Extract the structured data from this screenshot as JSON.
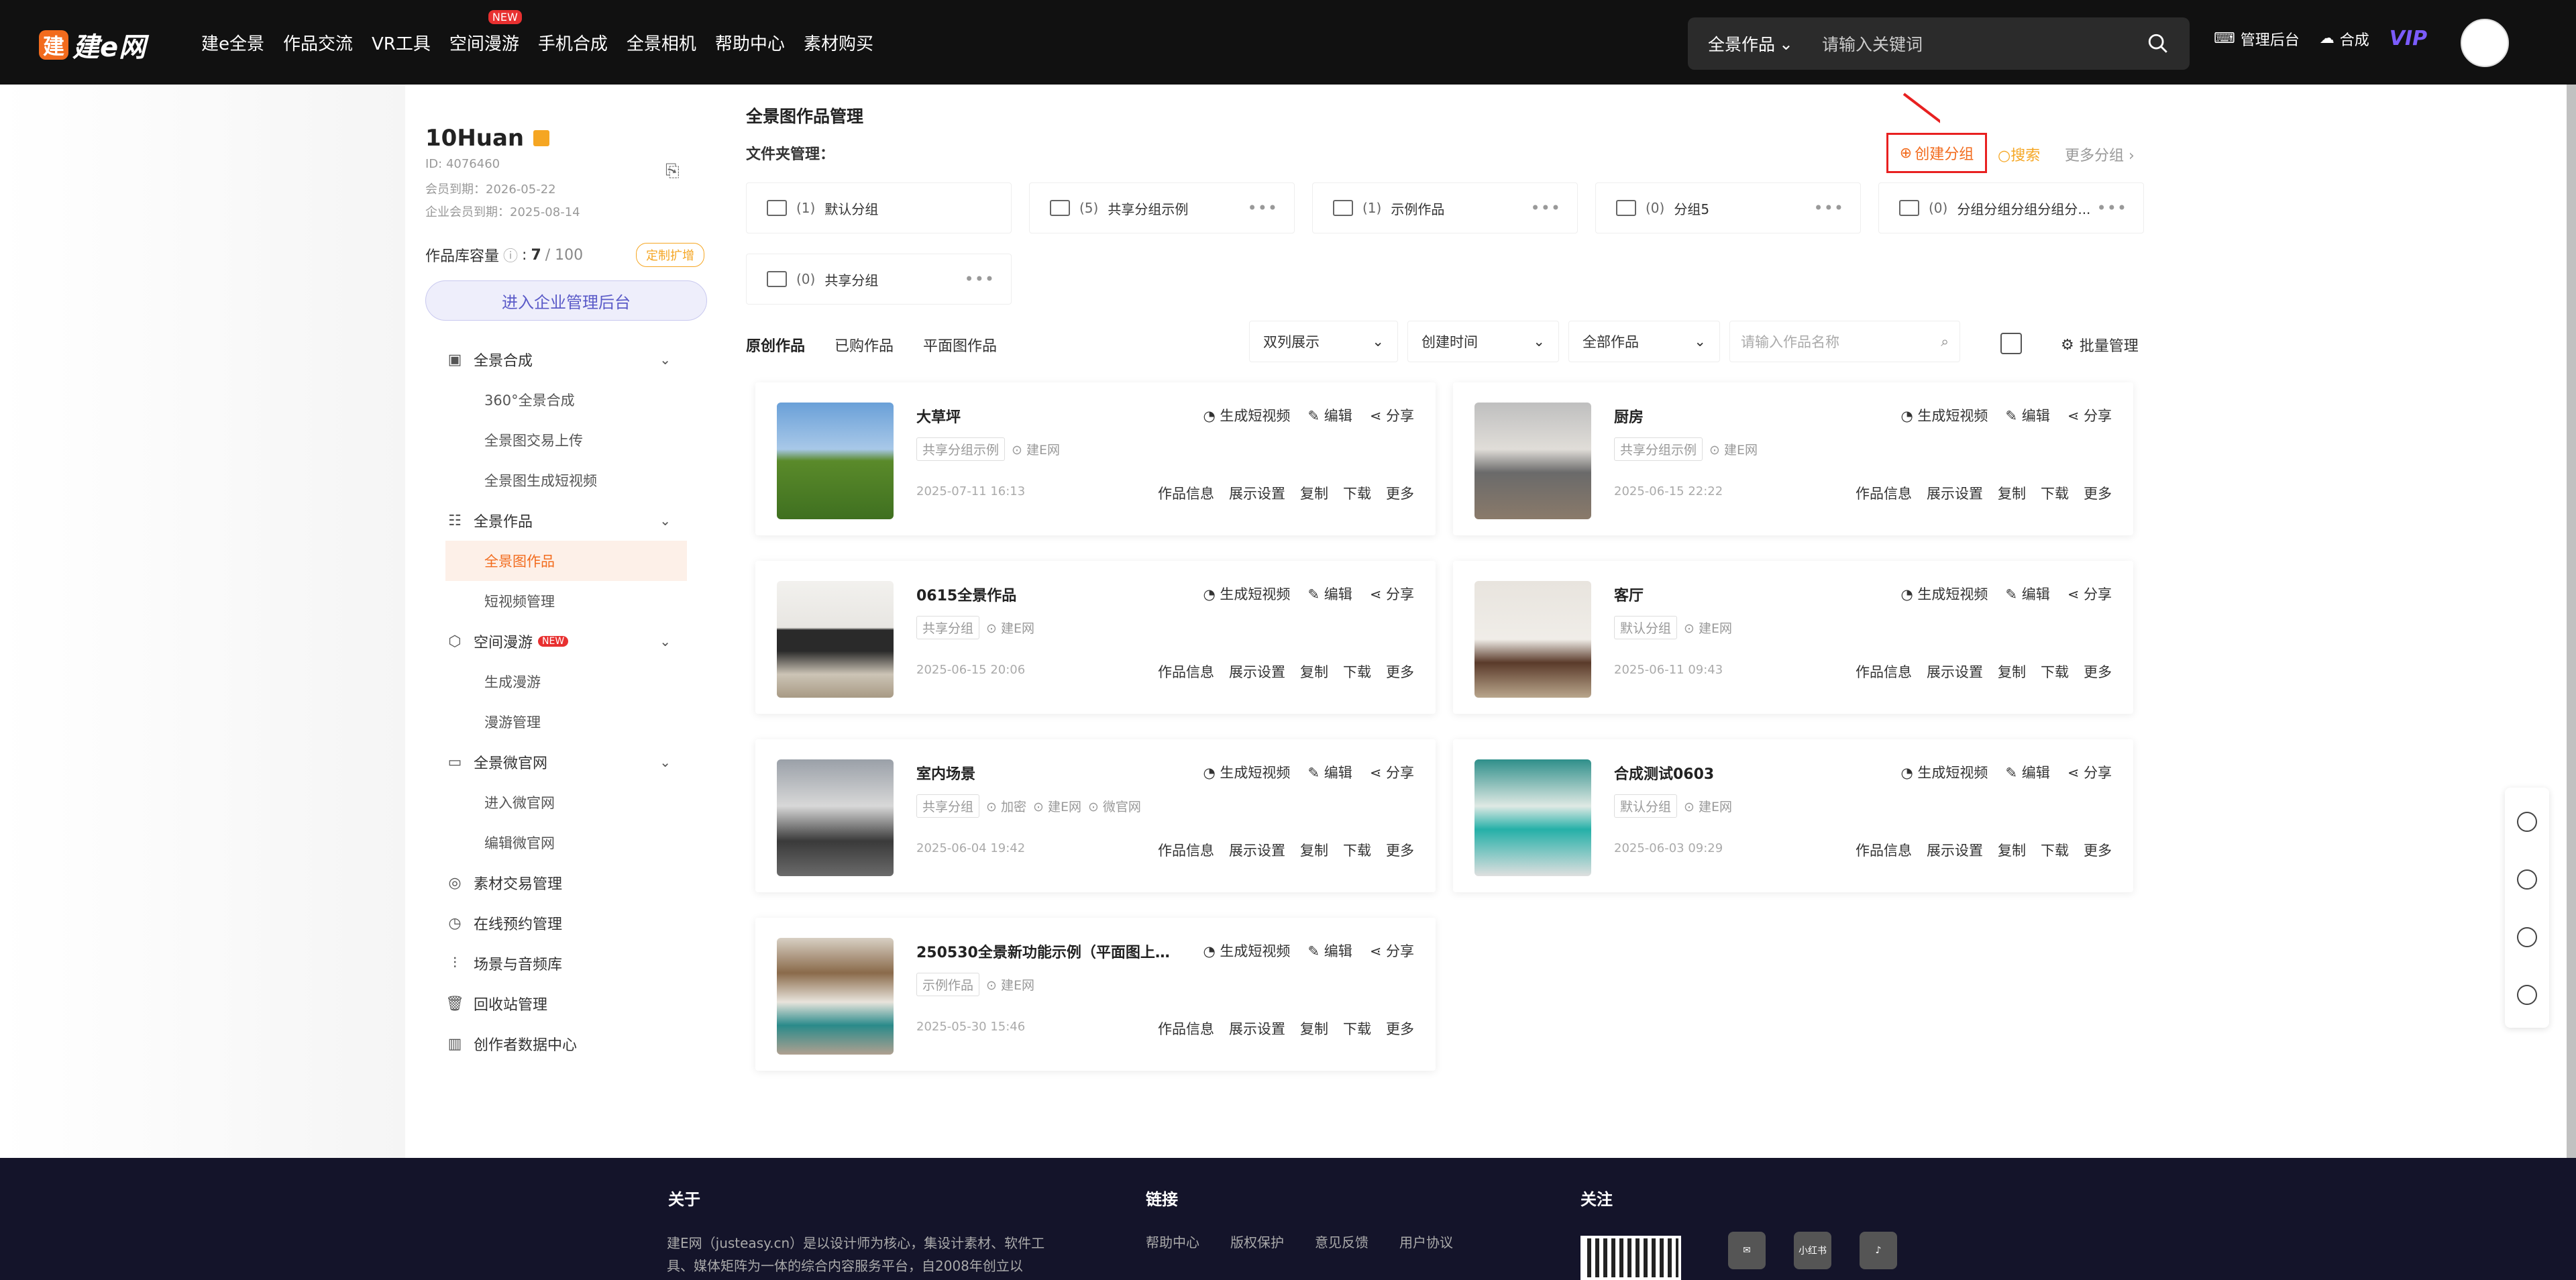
{
  "brand": {
    "logo_mark": "建",
    "logo_text": "建e网"
  },
  "nav": [
    "建e全景",
    "作品交流",
    "VR工具",
    "空间漫游",
    "手机合成",
    "全景相机",
    "帮助中心",
    "素材购买"
  ],
  "nav_badge": "NEW",
  "search": {
    "category": "全景作品",
    "placeholder": "请输入关键词"
  },
  "top_right": {
    "admin": "管理后台",
    "compose": "合成",
    "vip": "VIP"
  },
  "user": {
    "name": "10Huan",
    "id": "ID: 4076460",
    "member_expire": "会员到期：2026-05-22",
    "enterprise_expire": "企业会员到期：2025-08-14",
    "capacity_label": "作品库容量",
    "capacity_value": "7",
    "capacity_total": "/ 100",
    "custom_btn": "定制扩增",
    "enter_btn": "进入企业管理后台"
  },
  "menu": {
    "pano_compose": "全景合成",
    "sub_360": "360°全景合成",
    "sub_upload": "全景图交易上传",
    "sub_video": "全景图生成短视频",
    "pano_works": "全景作品",
    "sub_pano_works": "全景图作品",
    "sub_shortvideo": "短视频管理",
    "space_tour": "空间漫游",
    "new_badge": "NEW",
    "sub_gen_tour": "生成漫游",
    "sub_tour_mgr": "漫游管理",
    "micro_site": "全景微官网",
    "sub_enter_site": "进入微官网",
    "sub_edit_site": "编辑微官网",
    "material": "素材交易管理",
    "booking": "在线预约管理",
    "audio": "场景与音频库",
    "recycle": "回收站管理",
    "data_center": "创作者数据中心"
  },
  "header": {
    "title": "全景图作品管理",
    "folder_mgr": "文件夹管理：",
    "create_group": "创建分组",
    "search": "搜索",
    "more_groups": "更多分组"
  },
  "folders": [
    {
      "count": "(1)",
      "name": "默认分组"
    },
    {
      "count": "(5)",
      "name": "共享分组示例"
    },
    {
      "count": "(1)",
      "name": "示例作品"
    },
    {
      "count": "(0)",
      "name": "分组5"
    },
    {
      "count": "(0)",
      "name": "分组分组分组分组分..."
    },
    {
      "count": "(0)",
      "name": "共享分组"
    }
  ],
  "tabs": [
    "原创作品",
    "已购作品",
    "平面图作品"
  ],
  "filters": {
    "display": "双列展示",
    "sort": "创建时间",
    "scope": "全部作品",
    "name_placeholder": "请输入作品名称",
    "batch": "批量管理"
  },
  "card_actions": {
    "gen_video": "生成短视频",
    "edit": "编辑",
    "share": "分享",
    "info": "作品信息",
    "display": "展示设置",
    "copy": "复制",
    "download": "下载",
    "more": "更多"
  },
  "works": [
    {
      "title": "大草坪",
      "group": "共享分组示例",
      "tags": [
        "建E网"
      ],
      "date": "2025-07-11 16:13"
    },
    {
      "title": "厨房",
      "group": "共享分组示例",
      "tags": [
        "建E网"
      ],
      "date": "2025-06-15 22:22"
    },
    {
      "title": "0615全景作品",
      "group": "共享分组",
      "tags": [
        "建E网"
      ],
      "date": "2025-06-15 20:06"
    },
    {
      "title": "客厅",
      "group": "默认分组",
      "tags": [
        "建E网"
      ],
      "date": "2025-06-11 09:43"
    },
    {
      "title": "室内场景",
      "group": "共享分组",
      "tags": [
        "加密",
        "建E网",
        "微官网"
      ],
      "date": "2025-06-04 19:42"
    },
    {
      "title": "合成测试0603",
      "group": "默认分组",
      "tags": [
        "建E网"
      ],
      "date": "2025-06-03 09:29"
    },
    {
      "title": "250530全景新功能示例（平面图上传...",
      "group": "示例作品",
      "tags": [
        "建E网"
      ],
      "date": "2025-05-30 15:46"
    }
  ],
  "footer": {
    "about_title": "关于",
    "about_text": "建E网（justeasy.cn）是以设计师为核心，集设计素材、软件工具、媒体矩阵为一体的综合内容服务平台，自2008年创立以",
    "links_title": "链接",
    "links": [
      "帮助中心",
      "版权保护",
      "意见反馈",
      "用户协议"
    ],
    "follow_title": "关注",
    "xhs": "小红书"
  },
  "colors": {
    "accent": "#f26b1d",
    "nav_bg": "#111111",
    "footer_bg": "#14142a",
    "highlight_border": "#e82020"
  }
}
